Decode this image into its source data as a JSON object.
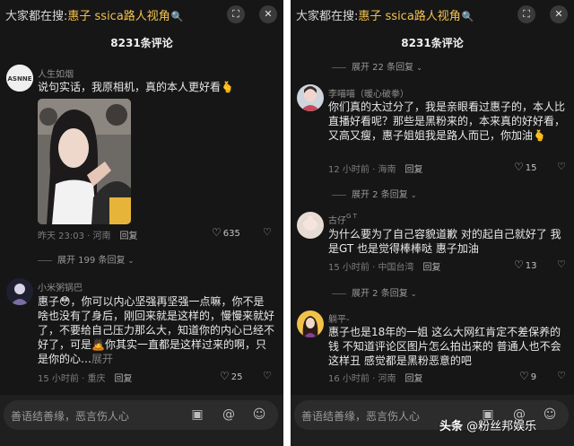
{
  "header": {
    "search_prefix": "大家都在搜:",
    "search_keyword": "惠子 ssica路人视角",
    "comment_count": "8231条评论"
  },
  "left": {
    "comment1": {
      "avatar_label": "ASNNE",
      "username": "人生如烟",
      "text": "说句实话，我原相机，真的本人更好看🫰",
      "time": "昨天 23:03 · 河南",
      "reply": "回复",
      "likes": "635"
    },
    "expand1": "展开 199 条回复",
    "comment2": {
      "username": "小米粥锅巴",
      "text": "惠子😳，你可以内心坚强再坚强一点嘛，你不是啥也没有了身后，刚回来就是这样的，慢慢来就好了，不要给自己压力那么大，知道你的内心已经不好了，可是🙇你其实一直都是这样过来的啊，只是你的心…",
      "more": "展开",
      "time": "15 小时前 · 重庆",
      "reply": "回复",
      "likes": "25"
    }
  },
  "right": {
    "expand0": "展开 22 条回复",
    "comment1": {
      "username": "李喵喵（暖心破拳）",
      "text": "你们真的太过分了，我是亲眼看过惠子的，本人比直播好看呢？那些是黑粉来的，本来真的好好看，又高又瘦，惠子姐姐我是路人而已，你加油🫰",
      "time": "12 小时前 · 海南",
      "reply": "回复",
      "likes": "15"
    },
    "expand1": "展开 2 条回复",
    "comment2": {
      "username": "古仔",
      "username_tag": "G T",
      "text": "为什么要为了自己容貌道歉 对的起自己就好了 我是GT 也是觉得棒棒哒 惠子加油",
      "time": "15 小时前 · 中国台湾",
      "reply": "回复",
      "likes": "13"
    },
    "expand2": "展开 2 条回复",
    "comment3": {
      "username": "躺平-",
      "text": "惠子也是18年的一姐 这么大网红肯定不差保养的钱 不知道评论区图片怎么拍出来的 普通人也不会这样丑 感觉都是黑粉恶意的吧",
      "time": "16 小时前 · 河南",
      "reply": "回复",
      "likes": "9"
    }
  },
  "input": {
    "placeholder": "善语结善缘，恶言伤人心"
  },
  "watermark": {
    "platform": "头条",
    "account": "@粉丝邦娱乐"
  },
  "colors": {
    "background": "#161616",
    "keyword": "#f3c24f",
    "text": "#e9e9e9",
    "muted": "#8e8e8e"
  },
  "icons": [
    "fullscreen-icon",
    "close-icon",
    "heart-icon",
    "dislike-heart-icon",
    "image-icon",
    "at-icon",
    "emoji-icon"
  ]
}
